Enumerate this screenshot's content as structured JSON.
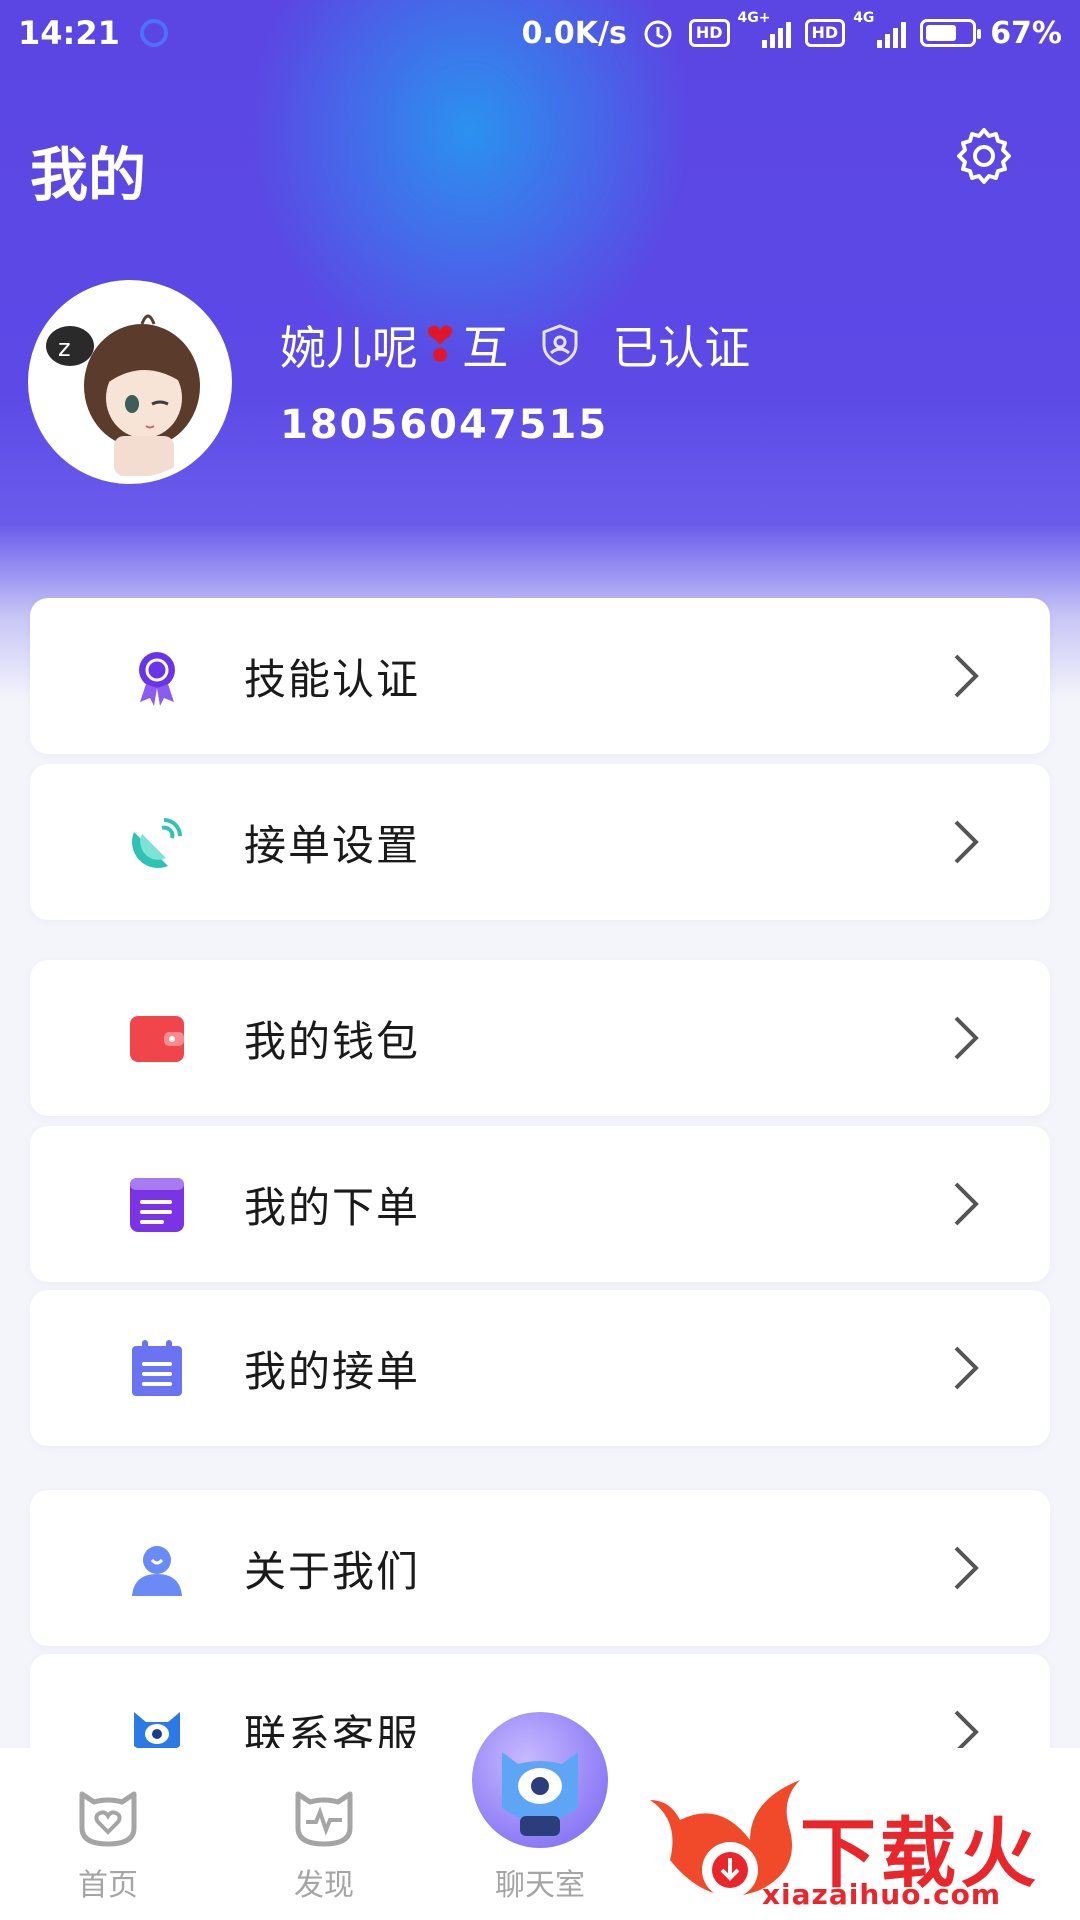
{
  "status_bar": {
    "time": "14:21",
    "network_speed": "0.0K/s",
    "hd_badge": "HD",
    "signal1_label": "4G+",
    "signal2_label": "4G",
    "battery_percent": "67%",
    "battery_level": 0.67
  },
  "header": {
    "title": "我的",
    "settings_icon": "gear-icon"
  },
  "profile": {
    "name_part1": "婉儿呢",
    "heart": "❣",
    "name_part2": "互",
    "verified_label": "已认证",
    "phone": "18056047515"
  },
  "menu": [
    {
      "label": "技能认证",
      "icon": "award-medal-icon",
      "color": "#6a35e8"
    },
    {
      "label": "接单设置",
      "icon": "satellite-dish-icon",
      "color": "#2fc3b6"
    },
    {
      "label": "我的钱包",
      "icon": "wallet-icon",
      "color": "#f0454b"
    },
    {
      "label": "我的下单",
      "icon": "order-list-icon",
      "color": "#7b33e6"
    },
    {
      "label": "我的接单",
      "icon": "clipboard-icon",
      "color": "#6a74f2"
    },
    {
      "label": "关于我们",
      "icon": "person-info-icon",
      "color": "#6a8af6"
    },
    {
      "label": "联系客服",
      "icon": "customer-service-icon",
      "color": "#2b7ae8"
    }
  ],
  "tabs": [
    {
      "label": "首页",
      "icon": "cat-heart-icon"
    },
    {
      "label": "发现",
      "icon": "cat-pulse-icon"
    },
    {
      "label": "聊天室",
      "icon": "cat-cyclops-icon"
    }
  ],
  "watermark": {
    "text": "下载火",
    "url": "xiazaihuo.com"
  }
}
